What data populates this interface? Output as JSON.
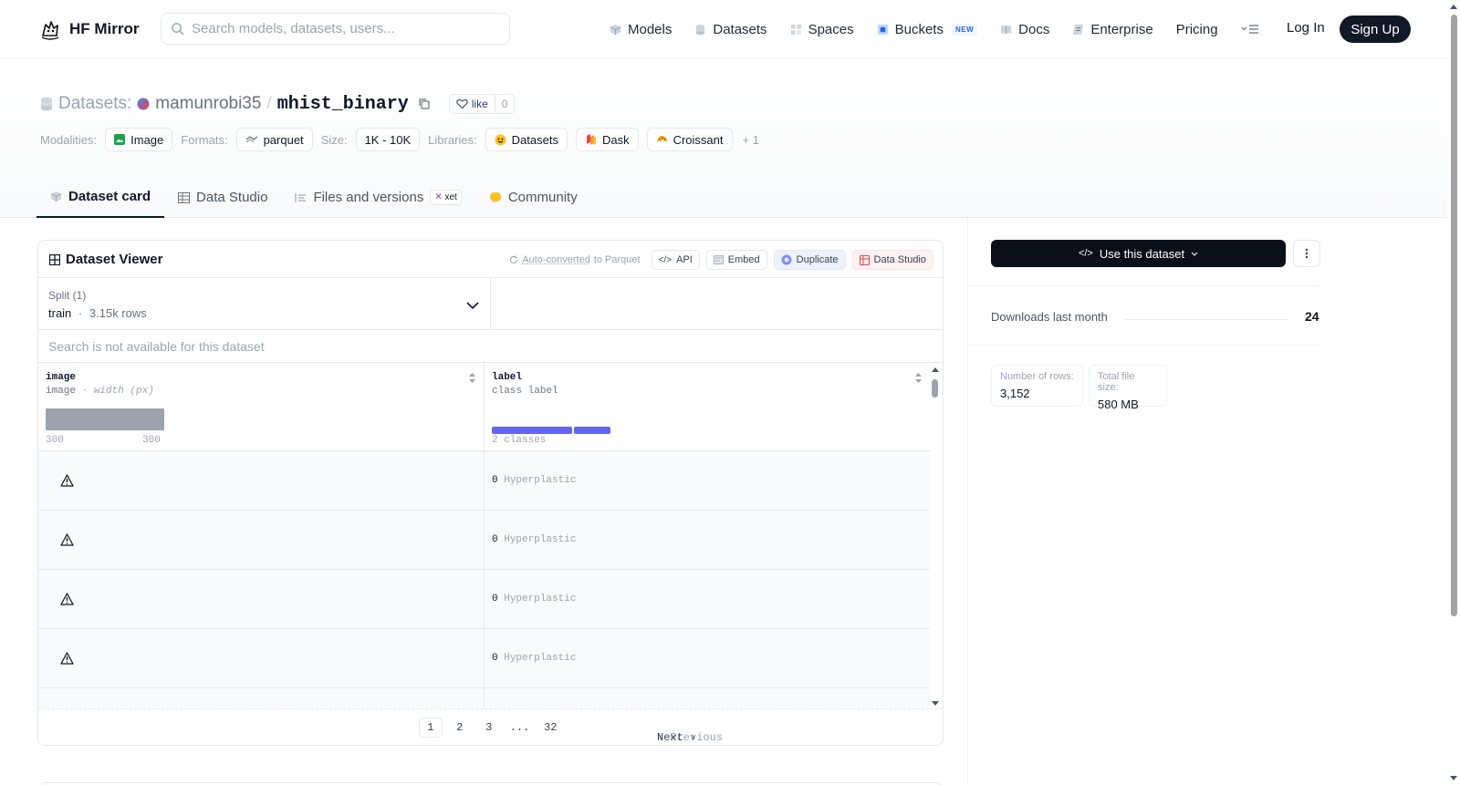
{
  "header": {
    "brand": "HF Mirror",
    "search_placeholder": "Search models, datasets, users...",
    "nav": [
      {
        "label": "Models",
        "icon": "models-icon"
      },
      {
        "label": "Datasets",
        "icon": "datasets-icon"
      },
      {
        "label": "Spaces",
        "icon": "spaces-icon"
      },
      {
        "label": "Buckets",
        "icon": "buckets-icon",
        "badge": "NEW"
      },
      {
        "label": "Docs",
        "icon": "docs-icon"
      },
      {
        "label": "Enterprise",
        "icon": "enterprise-icon"
      },
      {
        "label": "Pricing"
      }
    ],
    "login": "Log In",
    "signup": "Sign Up"
  },
  "repo": {
    "kind": "Datasets:",
    "owner": "mamunrobi35",
    "separator": "/",
    "name": "mhist_binary",
    "like_label": "like",
    "like_count": "0"
  },
  "meta": {
    "modalities_label": "Modalities:",
    "modality": "Image",
    "formats_label": "Formats:",
    "format": "parquet",
    "size_label": "Size:",
    "size": "1K - 10K",
    "libraries_label": "Libraries:",
    "libraries": [
      "Datasets",
      "Dask",
      "Croissant"
    ],
    "more": "+ 1"
  },
  "tabs": [
    {
      "label": "Dataset card",
      "active": true
    },
    {
      "label": "Data Studio"
    },
    {
      "label": "Files and versions",
      "badge": "xet"
    },
    {
      "label": "Community"
    }
  ],
  "viewer": {
    "title": "Dataset Viewer",
    "auto_converted": "Auto-converted",
    "to_parquet": "to Parquet",
    "api": "API",
    "embed": "Embed",
    "duplicate": "Duplicate",
    "data_studio": "Data Studio",
    "split_label": "Split (1)",
    "split_name": "train",
    "split_sep": "·",
    "split_rows": "3.15k rows",
    "search_na": "Search is not available for this dataset",
    "columns": [
      {
        "name": "image",
        "type": "image",
        "subtype": "· width (px)",
        "min": "300",
        "max": "300"
      },
      {
        "name": "label",
        "type": "class label",
        "summary": "2 classes"
      }
    ],
    "rows": [
      {
        "label_id": "0",
        "label_name": "Hyperplastic"
      },
      {
        "label_id": "0",
        "label_name": "Hyperplastic"
      },
      {
        "label_id": "0",
        "label_name": "Hyperplastic"
      },
      {
        "label_id": "0",
        "label_name": "Hyperplastic"
      }
    ],
    "pagination": {
      "previous": "Previous",
      "pages": [
        "1",
        "2",
        "3",
        "...",
        "32"
      ],
      "current": "1",
      "next": "Next"
    }
  },
  "side": {
    "use_button": "Use this dataset",
    "downloads_label": "Downloads last month",
    "downloads_value": "24",
    "rows_label": "Number of rows:",
    "rows_value": "3,152",
    "size_label": "Total file size:",
    "size_value": "580 MB"
  },
  "colors": {
    "accent_dark": "#111827",
    "class_bar": "#6366f1",
    "histogram": "#9ca3af"
  }
}
